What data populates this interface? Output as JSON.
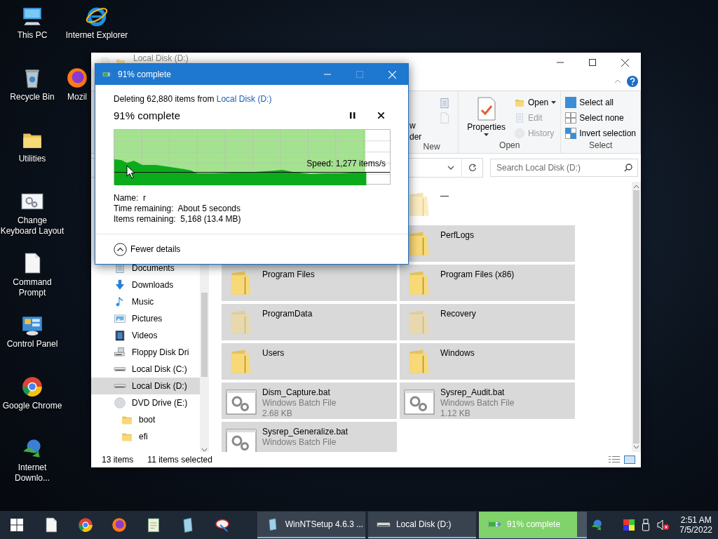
{
  "desktop": {
    "icons": [
      {
        "label": "This PC",
        "kind": "pc"
      },
      {
        "label": "Internet Explorer",
        "kind": "ie"
      },
      {
        "label": "Recycle Bin",
        "kind": "bin"
      },
      {
        "label": "Mozil",
        "kind": "firefox"
      },
      {
        "label": "Utilities",
        "kind": "folder"
      },
      {
        "label": "Change Keyboard Layout",
        "kind": "settings"
      },
      {
        "label": "Command Prompt",
        "kind": "file"
      },
      {
        "label": "Control Panel",
        "kind": "control"
      },
      {
        "label": "Google Chrome",
        "kind": "chrome"
      },
      {
        "label": "Internet Downlo...",
        "kind": "idm"
      }
    ]
  },
  "explorer": {
    "title": "Local Disk (D:)",
    "ribbon": {
      "new_group": {
        "label": "New",
        "button_lines": [
          "w",
          "der"
        ]
      },
      "open_group": {
        "label": "Open",
        "properties": "Properties",
        "items": [
          {
            "label": "Open",
            "disabled": false,
            "kind": "open"
          },
          {
            "label": "Edit",
            "disabled": true,
            "kind": "edit"
          },
          {
            "label": "History",
            "disabled": true,
            "kind": "history"
          }
        ]
      },
      "select_group": {
        "label": "Select",
        "items": [
          {
            "label": "Select all",
            "kind": "all"
          },
          {
            "label": "Select none",
            "kind": "none"
          },
          {
            "label": "Invert selection",
            "kind": "invert"
          }
        ]
      }
    },
    "search": {
      "placeholder": "Search Local Disk (D:)"
    },
    "nav": [
      {
        "label": "Documents",
        "kind": "documents",
        "selected": false
      },
      {
        "label": "Downloads",
        "kind": "downloads",
        "selected": false
      },
      {
        "label": "Music",
        "kind": "music",
        "selected": false
      },
      {
        "label": "Pictures",
        "kind": "pictures",
        "selected": false
      },
      {
        "label": "Videos",
        "kind": "videos",
        "selected": false
      },
      {
        "label": "Floppy Disk Dri",
        "kind": "floppy",
        "selected": false
      },
      {
        "label": "Local Disk (C:)",
        "kind": "drive",
        "selected": false
      },
      {
        "label": "Local Disk (D:)",
        "kind": "drive",
        "selected": true
      },
      {
        "label": "DVD Drive (E:)",
        "kind": "dvd",
        "selected": false,
        "children": [
          {
            "label": "boot",
            "kind": "folder",
            "selected": false
          },
          {
            "label": "efi",
            "kind": "folder",
            "selected": false
          }
        ]
      }
    ],
    "items": [
      {
        "name": "—",
        "kind": "folder",
        "hidden": true,
        "selected": false
      },
      {
        "name": "PerfLogs",
        "kind": "folder",
        "hidden": false,
        "selected": true
      },
      {
        "name": "Program Files",
        "kind": "folder",
        "hidden": false,
        "selected": true
      },
      {
        "name": "Program Files (x86)",
        "kind": "folder",
        "hidden": false,
        "selected": true
      },
      {
        "name": "ProgramData",
        "kind": "folder",
        "hidden": true,
        "selected": true
      },
      {
        "name": "Recovery",
        "kind": "folder",
        "hidden": true,
        "selected": true
      },
      {
        "name": "Users",
        "kind": "folder",
        "hidden": false,
        "selected": true
      },
      {
        "name": "Windows",
        "kind": "folder",
        "hidden": false,
        "selected": true
      },
      {
        "name": "Dism_Capture.bat",
        "kind": "bat",
        "type": "Windows Batch File",
        "size": "2.68 KB",
        "hidden": false,
        "selected": true
      },
      {
        "name": "Sysrep_Audit.bat",
        "kind": "bat",
        "type": "Windows Batch File",
        "size": "1.12 KB",
        "hidden": false,
        "selected": true
      },
      {
        "name": "Sysrep_Generalize.bat",
        "kind": "bat",
        "type": "Windows Batch File",
        "hidden": false,
        "selected": true
      }
    ],
    "status": {
      "count": "13 items",
      "selection": "11 items selected"
    }
  },
  "dialog": {
    "title": "91% complete",
    "source_text": "Deleting 62,880 items from ",
    "source_link": "Local Disk (D:)",
    "heading": "91% complete",
    "progress": {
      "level": 0.91,
      "speed": "Speed: 1,277 items/s"
    },
    "details": [
      {
        "label": "Name:",
        "value": "r"
      },
      {
        "label": "Time remaining:",
        "value": "About 5 seconds"
      },
      {
        "label": "Items remaining:",
        "value": "5,168 (13.4 MB)"
      }
    ],
    "toggle": "Fewer details"
  },
  "taskbar": {
    "pinned": [
      {
        "kind": "file"
      },
      {
        "kind": "chrome"
      },
      {
        "kind": "firefox"
      },
      {
        "kind": "notes"
      },
      {
        "kind": "setup"
      },
      {
        "kind": "tool"
      }
    ],
    "tasks": [
      {
        "label": "WinNTSetup 4.6.3 ...",
        "kind": "setup"
      },
      {
        "label": "Local Disk (D:)",
        "kind": "drive"
      },
      {
        "label": "91% complete",
        "kind": "progress",
        "level": 0.91
      }
    ],
    "tray": {
      "time": "2:51 AM",
      "date": "7/5/2022"
    }
  }
}
